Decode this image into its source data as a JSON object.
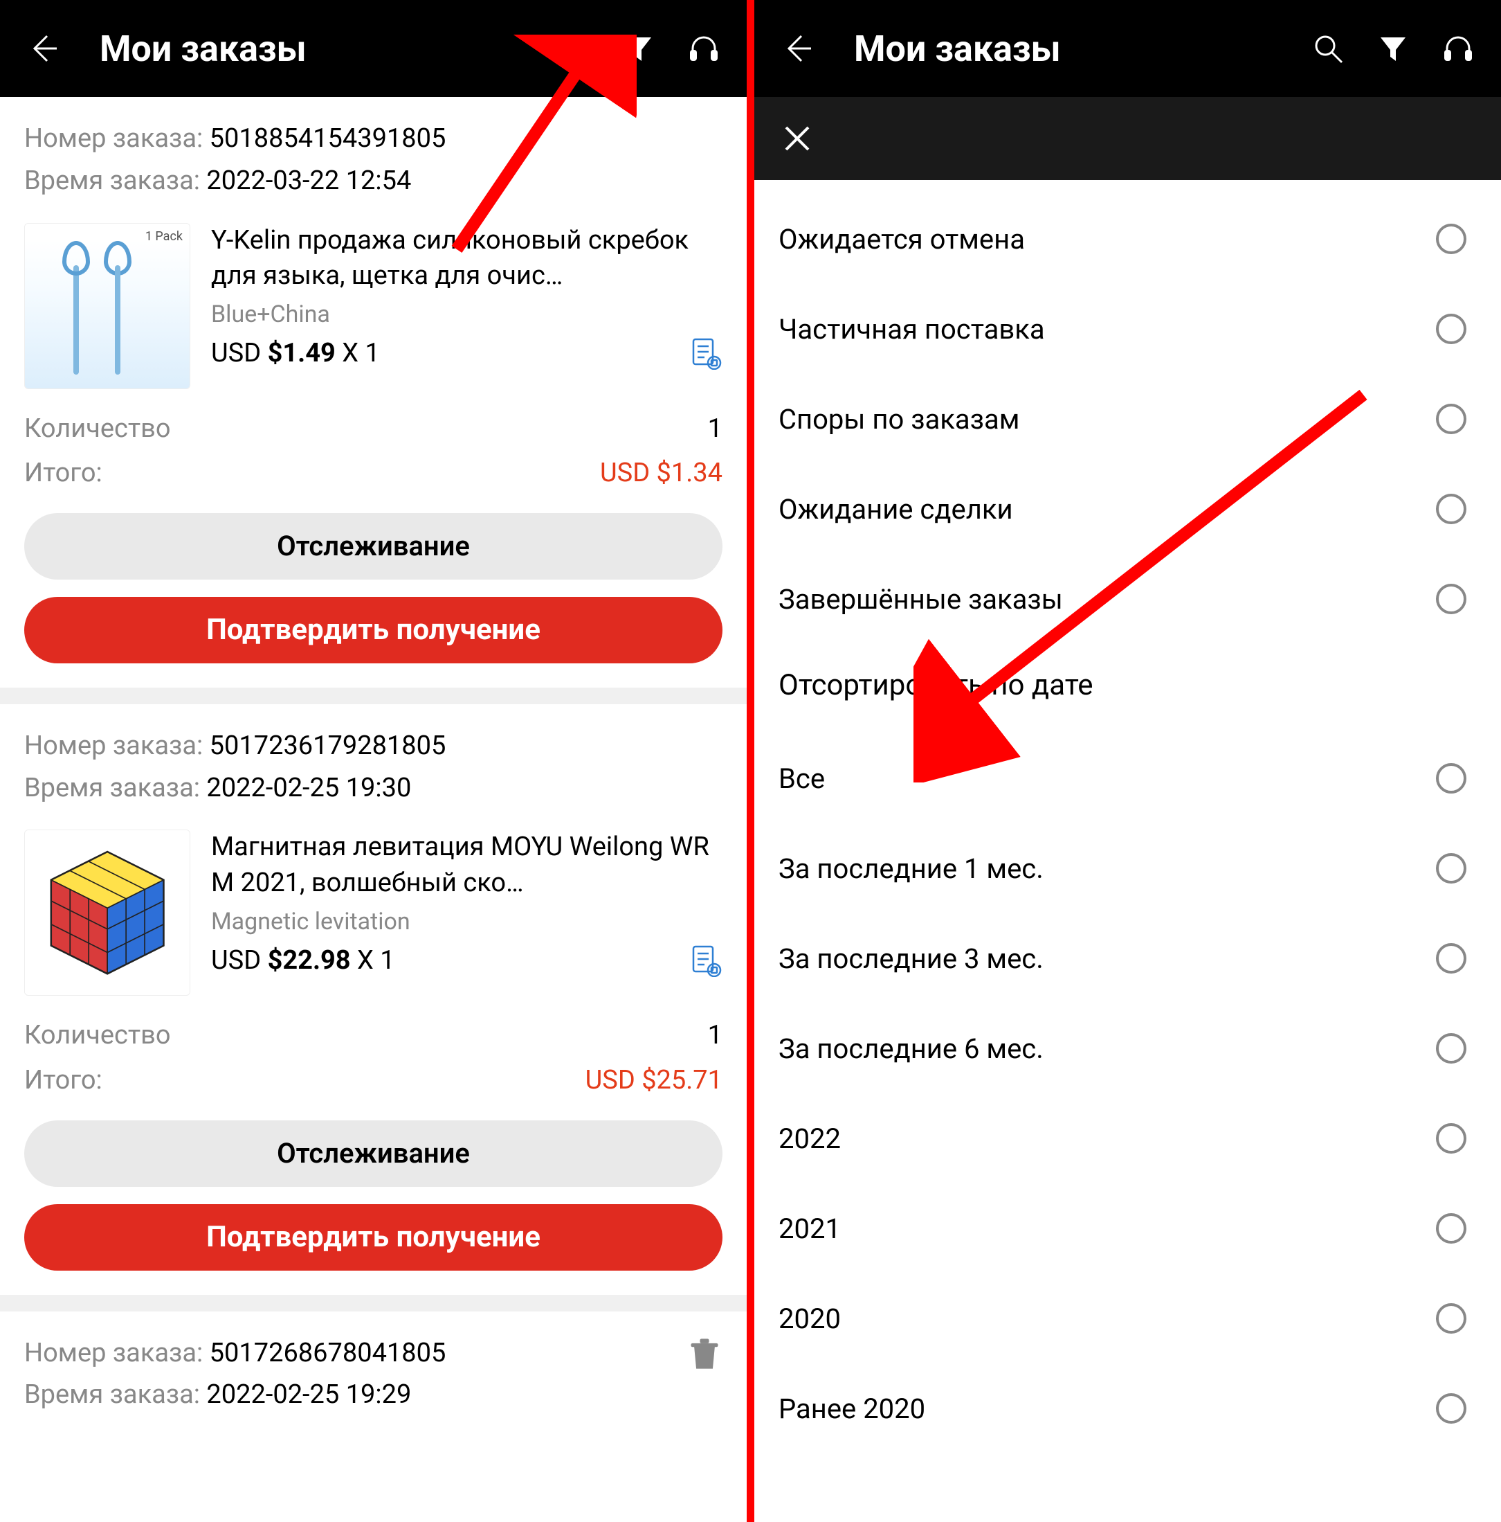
{
  "header": {
    "title": "Мои заказы"
  },
  "orders": [
    {
      "number_label": "Номер заказа: ",
      "number": "5018854154391805",
      "time_label": "Время заказа: ",
      "time": "2022-03-22 12:54",
      "product_title": "Y-Kelin продажа силиконовый скребок для языка, щетка для очис…",
      "variant": "Blue+China",
      "price_prefix": "USD ",
      "price": "$1.49",
      "qty_sep": " X ",
      "qty": "1",
      "pack_badge": "1 Pack",
      "qty_label": "Количество",
      "qty_total": "1",
      "total_label": "Итого:",
      "total": "USD $1.34",
      "track_btn": "Отслеживание",
      "confirm_btn": "Подтвердить получение"
    },
    {
      "number_label": "Номер заказа: ",
      "number": "5017236179281805",
      "time_label": "Время заказа: ",
      "time": "2022-02-25 19:30",
      "product_title": "Магнитная левитация MOYU Weilong WR M 2021, волшебный ско…",
      "variant": "Magnetic levitation",
      "price_prefix": "USD ",
      "price": "$22.98",
      "qty_sep": " X ",
      "qty": "1",
      "qty_label": "Количество",
      "qty_total": "1",
      "total_label": "Итого:",
      "total": "USD $25.71",
      "track_btn": "Отслеживание",
      "confirm_btn": "Подтвердить получение"
    },
    {
      "number_label": "Номер заказа: ",
      "number": "5017268678041805",
      "time_label": "Время заказа: ",
      "time": "2022-02-25 19:29"
    }
  ],
  "filters": {
    "status": [
      "Ожидается отмена",
      "Частичная поставка",
      "Споры по заказам",
      "Ожидание сделки",
      "Завершённые заказы"
    ],
    "sort_title": "Отсортировать по дате",
    "dates": [
      "Все",
      "За последние 1 мес.",
      "За последние 3 мес.",
      "За последние 6 мес.",
      "2022",
      "2021",
      "2020",
      "Ранее 2020"
    ]
  }
}
